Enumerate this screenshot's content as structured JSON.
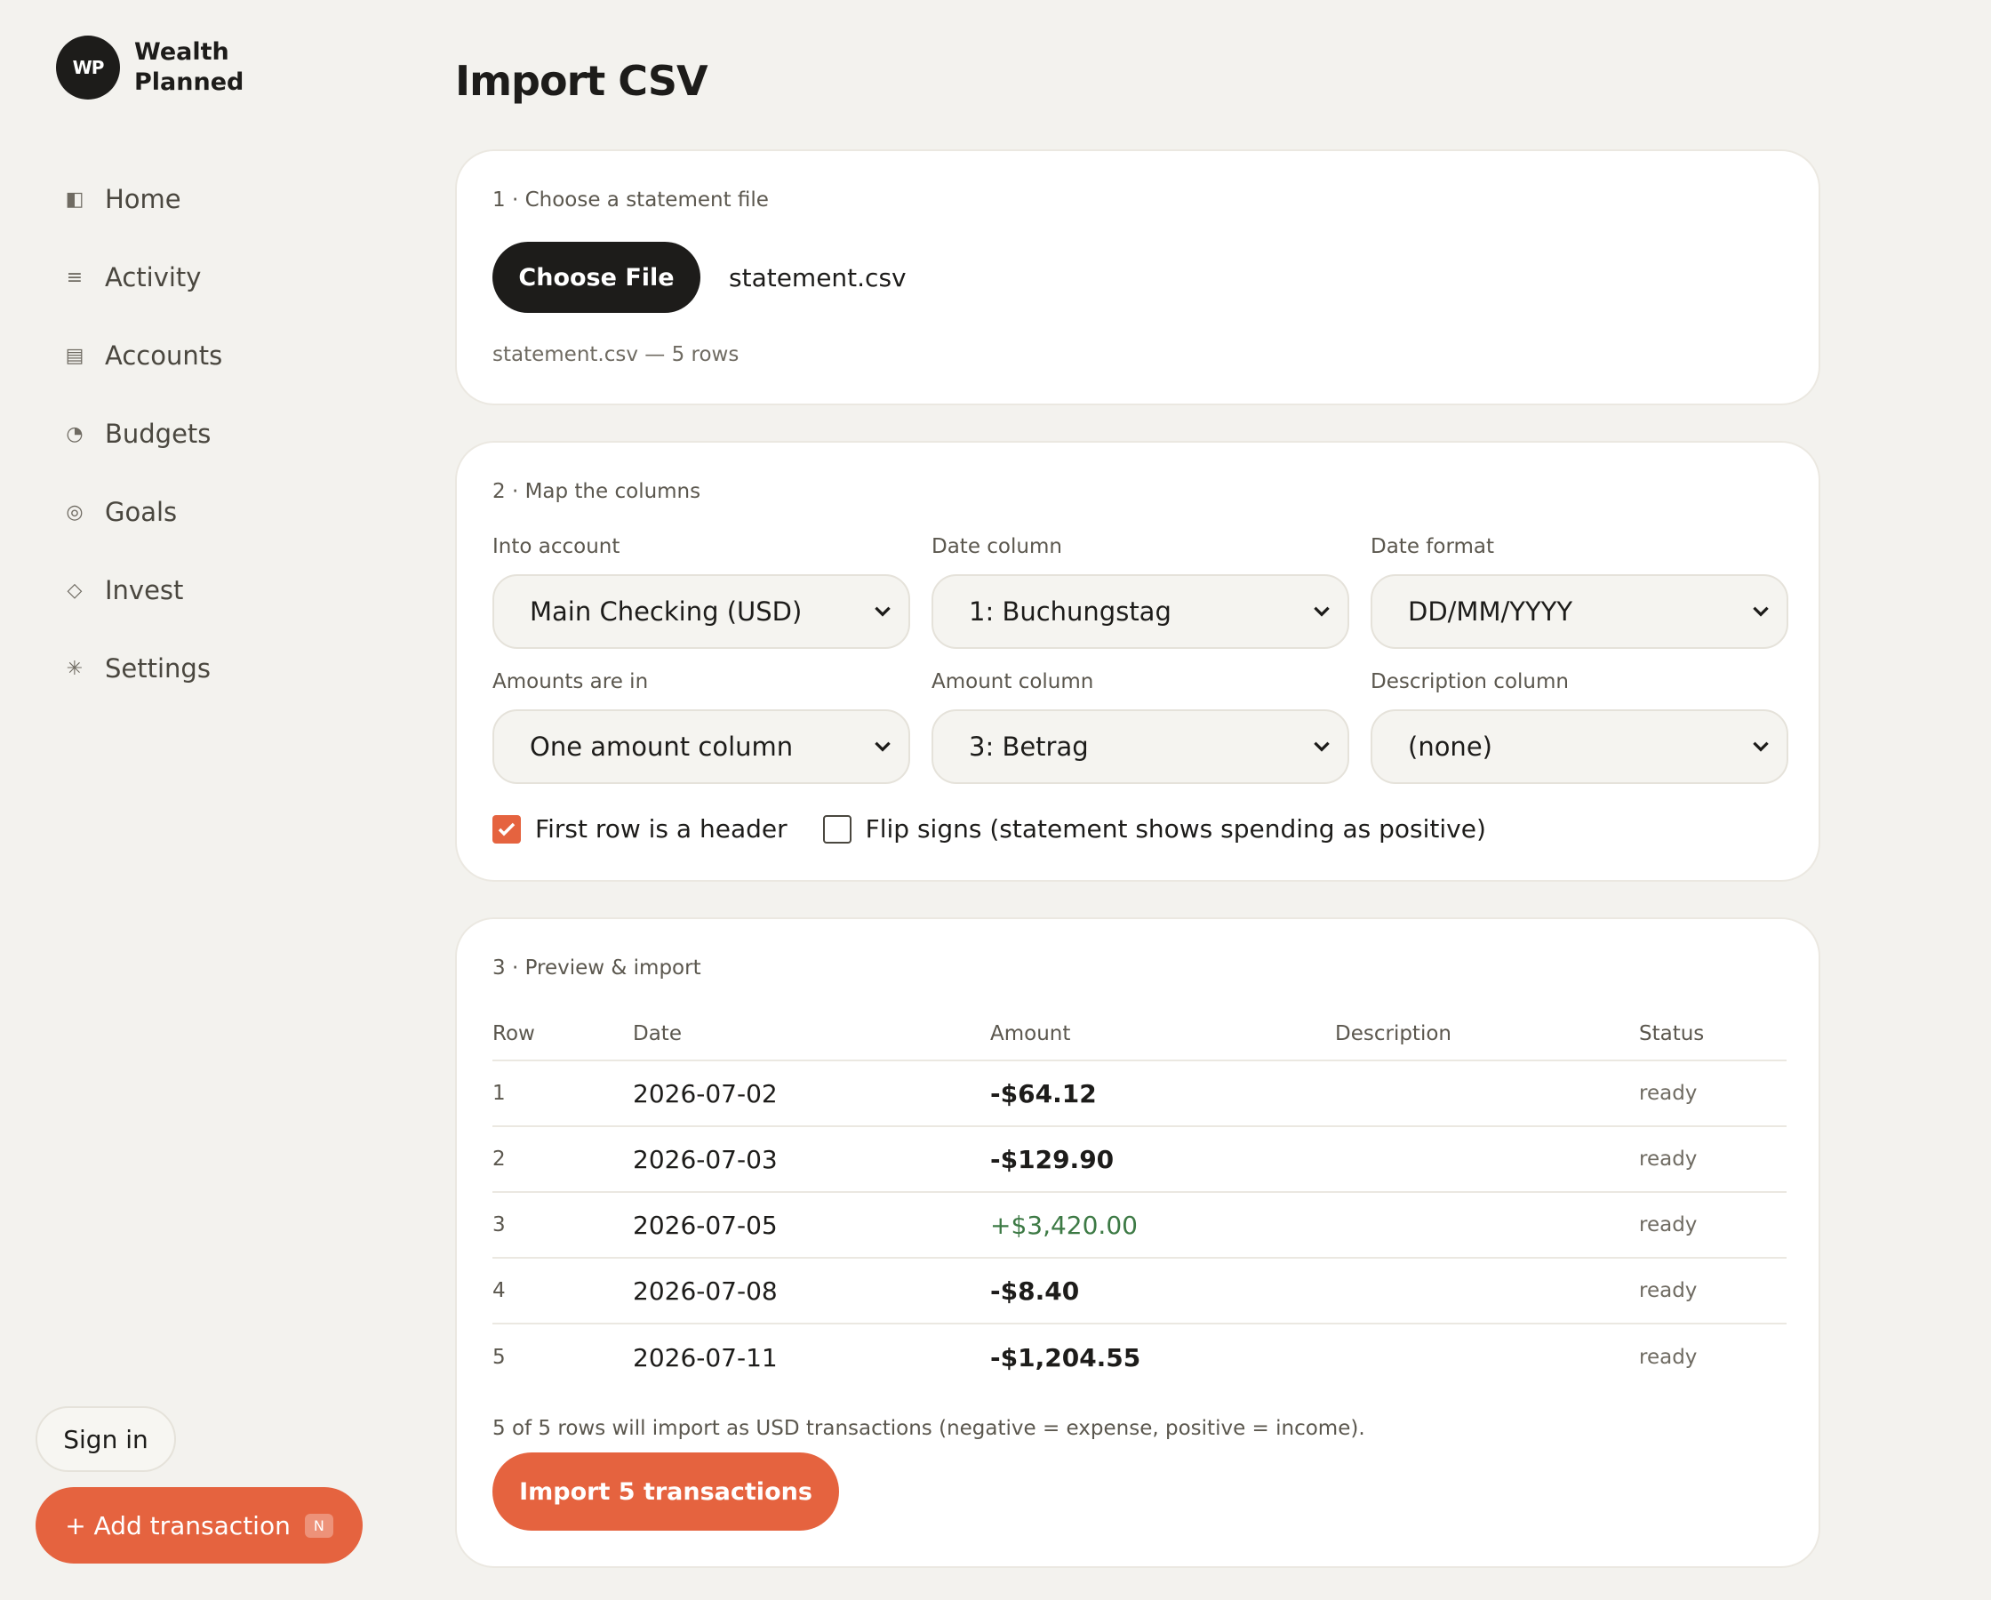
{
  "brand": {
    "initials": "WP",
    "name": "Wealth Planned"
  },
  "nav": [
    {
      "label": "Home",
      "icon": "◧"
    },
    {
      "label": "Activity",
      "icon": "≡"
    },
    {
      "label": "Accounts",
      "icon": "▤"
    },
    {
      "label": "Budgets",
      "icon": "◔"
    },
    {
      "label": "Goals",
      "icon": "◎"
    },
    {
      "label": "Invest",
      "icon": "◇"
    },
    {
      "label": "Settings",
      "icon": "✳"
    }
  ],
  "sidebar": {
    "signin_label": "Sign in",
    "add_label": "+ Add transaction",
    "add_shortcut": "N"
  },
  "page": {
    "title": "Import CSV"
  },
  "step1": {
    "title": "1 · Choose a statement file",
    "choose_label": "Choose File",
    "file_name": "statement.csv",
    "file_meta": "statement.csv — 5 rows"
  },
  "step2": {
    "title": "2 · Map the columns",
    "fields": {
      "account": {
        "label": "Into account",
        "value": "Main Checking (USD)"
      },
      "date_col": {
        "label": "Date column",
        "value": "1: Buchungstag"
      },
      "date_fmt": {
        "label": "Date format",
        "value": "DD/MM/YYYY"
      },
      "amounts": {
        "label": "Amounts are in",
        "value": "One amount column"
      },
      "amount_col": {
        "label": "Amount column",
        "value": "3: Betrag"
      },
      "desc_col": {
        "label": "Description column",
        "value": "(none)"
      }
    },
    "header_check": {
      "label": "First row is a header",
      "checked": true
    },
    "flip_check": {
      "label": "Flip signs (statement shows spending as positive)",
      "checked": false
    }
  },
  "step3": {
    "title": "3 · Preview & import",
    "columns": [
      "Row",
      "Date",
      "Amount",
      "Description",
      "Status"
    ],
    "rows": [
      {
        "row": "1",
        "date": "2026-07-02",
        "amount": "-$64.12",
        "description": "",
        "status": "ready"
      },
      {
        "row": "2",
        "date": "2026-07-03",
        "amount": "-$129.90",
        "description": "",
        "status": "ready"
      },
      {
        "row": "3",
        "date": "2026-07-05",
        "amount": "+$3,420.00",
        "description": "",
        "status": "ready"
      },
      {
        "row": "4",
        "date": "2026-07-08",
        "amount": "-$8.40",
        "description": "",
        "status": "ready"
      },
      {
        "row": "5",
        "date": "2026-07-11",
        "amount": "-$1,204.55",
        "description": "",
        "status": "ready"
      }
    ],
    "summary": "5 of 5 rows will import as USD transactions (negative = expense, positive = income).",
    "import_label": "Import 5 transactions"
  },
  "colors": {
    "accent": "#e5633f",
    "positive": "#3d7a45",
    "dark": "#1d1c1a"
  }
}
